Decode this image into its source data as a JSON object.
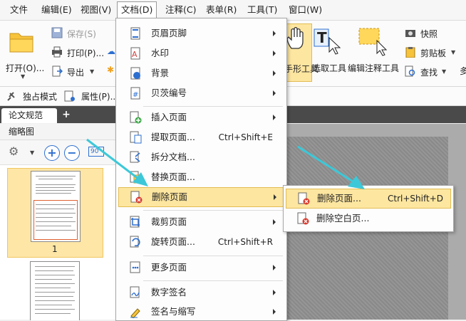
{
  "menubar": {
    "items": [
      "文件",
      "编辑(E)",
      "视图(V)",
      "文档(D)",
      "注释(C)",
      "表单(R)",
      "工具(T)",
      "窗口(W)"
    ]
  },
  "ribbon": {
    "open": "打开(O)...",
    "save": "保存(S)",
    "print": "打印(P)...",
    "export": "导出",
    "hand_tool": "手形工具",
    "select_text": "选取工具",
    "edit_annot": "编辑注释工具",
    "snapshot": "快照",
    "clipboard": "剪贴板",
    "find": "查找",
    "trailing": "多"
  },
  "row2": {
    "exclusive": "独占模式",
    "properties": "属性(P)..."
  },
  "tabs": {
    "active": "论文规范",
    "add": "+"
  },
  "thumbnails": {
    "title": "缩略图",
    "page1": "1",
    "zoom_in": "+",
    "zoom_out": "−",
    "rotate": "90°"
  },
  "dropdown": {
    "items": [
      {
        "label": "页眉页脚",
        "shortcut": "",
        "submenu": true
      },
      {
        "label": "水印",
        "shortcut": "",
        "submenu": true
      },
      {
        "label": "背景",
        "shortcut": "",
        "submenu": true
      },
      {
        "label": "贝茨编号",
        "shortcut": "",
        "submenu": true
      },
      {
        "label": "插入页面",
        "shortcut": "",
        "submenu": true
      },
      {
        "label": "提取页面...",
        "shortcut": "Ctrl+Shift+E",
        "submenu": false
      },
      {
        "label": "拆分文档...",
        "shortcut": "",
        "submenu": false
      },
      {
        "label": "替换页面...",
        "shortcut": "",
        "submenu": false
      },
      {
        "label": "删除页面",
        "shortcut": "",
        "submenu": true
      },
      {
        "label": "裁剪页面",
        "shortcut": "",
        "submenu": true
      },
      {
        "label": "旋转页面...",
        "shortcut": "Ctrl+Shift+R",
        "submenu": false
      },
      {
        "label": "更多页面",
        "shortcut": "",
        "submenu": true
      },
      {
        "label": "数字签名",
        "shortcut": "",
        "submenu": true
      },
      {
        "label": "签名与缩写",
        "shortcut": "",
        "submenu": true
      }
    ]
  },
  "submenu": {
    "items": [
      {
        "label": "删除页面...",
        "shortcut": "Ctrl+Shift+D"
      },
      {
        "label": "删除空白页..."
      }
    ]
  },
  "colors": {
    "highlight": "#fde6a0",
    "accent_blue": "#2d6fd0",
    "arrow_teal": "#3cc8d8"
  }
}
